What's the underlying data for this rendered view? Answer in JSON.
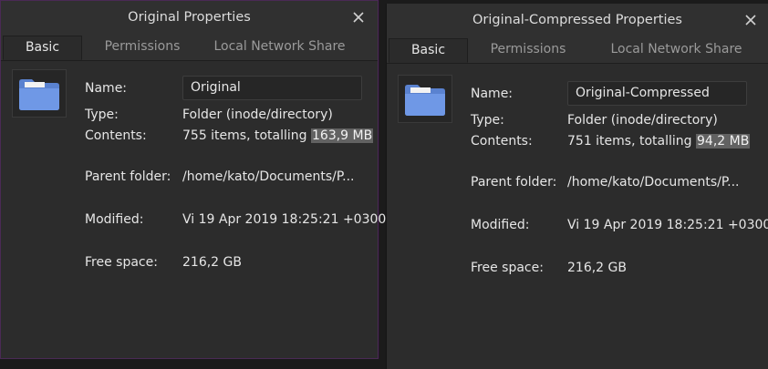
{
  "dialogs": [
    {
      "title": "Original Properties",
      "tabs": [
        "Basic",
        "Permissions",
        "Local Network Share"
      ],
      "labels": {
        "name": "Name:",
        "type": "Type:",
        "contents": "Contents:",
        "parent": "Parent folder:",
        "modified": "Modified:",
        "free": "Free space:"
      },
      "name_value": "Original",
      "type_value": "Folder (inode/directory)",
      "contents_prefix": "755 items, totalling ",
      "contents_size": "163,9 MB",
      "parent_value": "/home/kato/Documents/P...",
      "modified_value": "Vi 19 Apr 2019 18:25:21 +0300",
      "free_value": "216,2 GB",
      "icon": "folder-icon"
    },
    {
      "title": "Original-Compressed Properties",
      "tabs": [
        "Basic",
        "Permissions",
        "Local Network Share"
      ],
      "labels": {
        "name": "Name:",
        "type": "Type:",
        "contents": "Contents:",
        "parent": "Parent folder:",
        "modified": "Modified:",
        "free": "Free space:"
      },
      "name_value": "Original-Compressed",
      "type_value": "Folder (inode/directory)",
      "contents_prefix": "751 items, totalling ",
      "contents_size": "94,2 MB",
      "parent_value": "/home/kato/Documents/P...",
      "modified_value": "Vi 19 Apr 2019 18:25:21 +0300",
      "free_value": "216,2 GB",
      "icon": "folder-icon"
    }
  ],
  "colors": {
    "folder": "#6f98e6",
    "selection": "#626262",
    "window_bg": "#303030"
  }
}
